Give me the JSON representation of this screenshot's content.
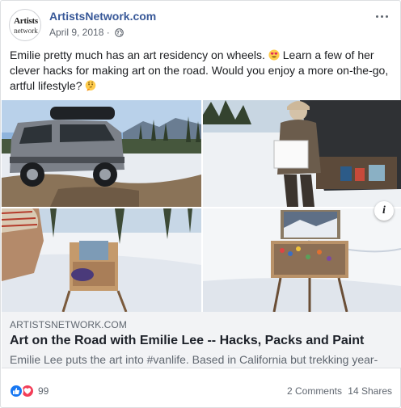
{
  "post": {
    "page_name": "ArtistsNetwork.com",
    "avatar_line1": "Artists",
    "avatar_line2": "network",
    "date": "April 9, 2018 ·",
    "privacy_icon": "globe-icon",
    "more_icon": "more-options-icon",
    "text_part1": "Emilie pretty much has an art residency on wheels.",
    "text_part2": " Learn a few of her clever hacks for making art on the road. Would you enjoy a more on-the-go, artful lifestyle?",
    "emoji1": "heart-eyes-emoji",
    "emoji2": "thinking-face-emoji"
  },
  "link": {
    "domain": "ARTISTSNETWORK.COM",
    "title": "Art on the Road with Emilie Lee -- Hacks, Packs and Paint",
    "description": "Emilie Lee puts the art into #vanlife. Based in California but trekking year-",
    "info_label": "i"
  },
  "footer": {
    "reaction_count": "99",
    "comments": "2 Comments",
    "shares": "14 Shares"
  },
  "colors": {
    "link_blue": "#385898",
    "like_blue": "#1877f2",
    "love_red": "#f33e58",
    "meta_gray": "#616770",
    "link_bg": "#f2f3f5"
  }
}
